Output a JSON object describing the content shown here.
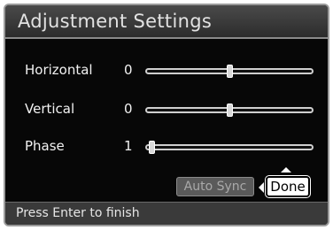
{
  "header": {
    "title": "Adjustment Settings"
  },
  "rows": [
    {
      "label": "Horizontal",
      "value": "0",
      "position": 0.5
    },
    {
      "label": "Vertical",
      "value": "0",
      "position": 0.5
    },
    {
      "label": "Phase",
      "value": "1",
      "position": 0.0
    }
  ],
  "buttons": {
    "auto_sync": "Auto Sync",
    "done": "Done"
  },
  "footer": {
    "hint": "Press Enter to finish"
  }
}
